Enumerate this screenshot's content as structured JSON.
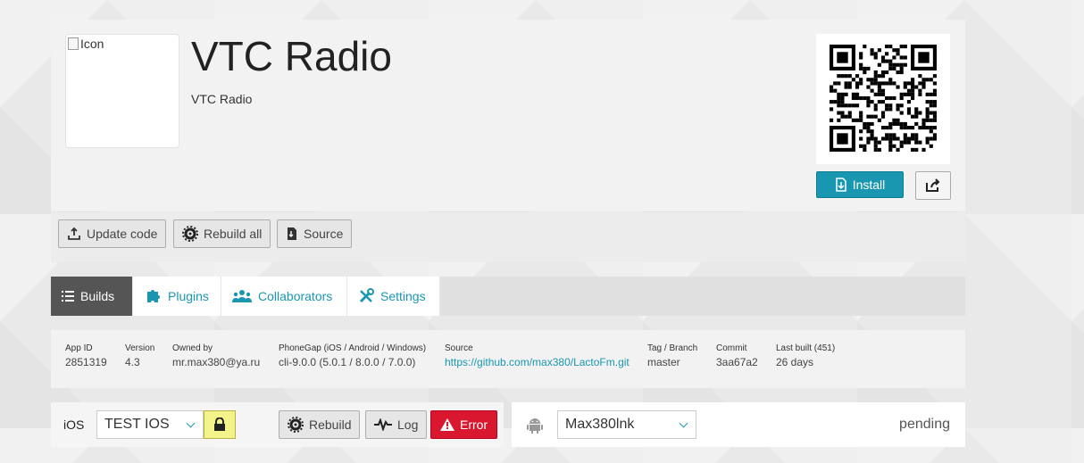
{
  "app": {
    "icon_alt": "Icon",
    "title": "VTC Radio",
    "subtitle": "VTC Radio",
    "qr_icon": "qr-code"
  },
  "header_buttons": {
    "install_label": "Install",
    "install_icon": "install-icon",
    "share_icon": "share-icon"
  },
  "actions": [
    {
      "label": "Update code",
      "icon": "upload-icon"
    },
    {
      "label": "Rebuild all",
      "icon": "gear-icon"
    },
    {
      "label": "Source",
      "icon": "download-file-icon"
    }
  ],
  "tabs": [
    {
      "label": "Builds",
      "icon": "list-icon",
      "active": true
    },
    {
      "label": "Plugins",
      "icon": "puzzle-icon",
      "active": false
    },
    {
      "label": "Collaborators",
      "icon": "users-icon",
      "active": false
    },
    {
      "label": "Settings",
      "icon": "tools-icon",
      "active": false
    }
  ],
  "info": [
    {
      "label": "App ID",
      "value": "2851319"
    },
    {
      "label": "Version",
      "value": "4.3"
    },
    {
      "label": "Owned by",
      "value": "mr.max380@ya.ru"
    },
    {
      "label": "PhoneGap (iOS / Android / Windows)",
      "value": "cli-9.0.0 (5.0.1 / 8.0.0 / 7.0.0)"
    },
    {
      "label": "Source",
      "value": "https://github.com/max380/LactoFm.git"
    },
    {
      "label": "Tag / Branch",
      "value": "master"
    },
    {
      "label": "Commit",
      "value": "3aa67a2"
    },
    {
      "label": "Last built (451)",
      "value": "26 days"
    }
  ],
  "ios": {
    "platform_label": "iOS",
    "key_value": "TEST IOS",
    "lock_icon": "lock-icon",
    "rebuild_label": "Rebuild",
    "log_label": "Log",
    "error_label": "Error"
  },
  "android": {
    "platform_icon": "android-icon",
    "key_value": "Max380lnk",
    "status": "pending"
  },
  "colors": {
    "accent": "#1a97b0",
    "error": "#d9182f",
    "tab_active": "#555555"
  }
}
